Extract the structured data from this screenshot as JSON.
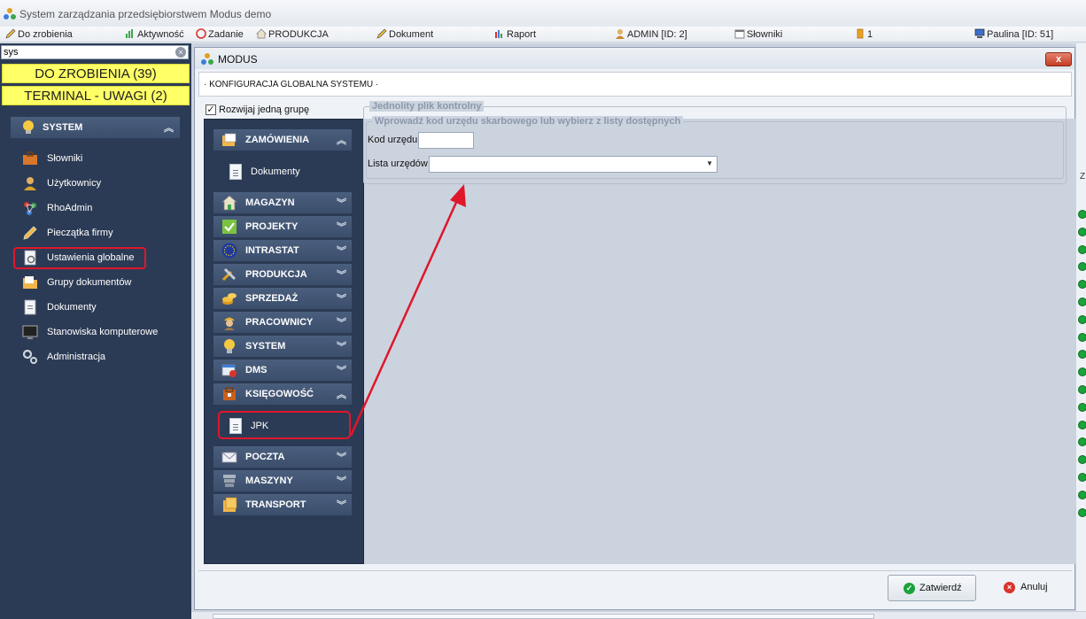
{
  "window": {
    "title": "System zarządzania przedsiębiorstwem Modus demo"
  },
  "menubar": {
    "items": [
      {
        "label": "Do zrobienia",
        "icon": "pencil-icon"
      },
      {
        "label": "Aktywność",
        "icon": "chart-icon"
      },
      {
        "label": "Zadanie",
        "icon": "task-icon"
      },
      {
        "label": "PRODUKCJA",
        "icon": "home-icon"
      },
      {
        "label": "Dokument",
        "icon": "pencil-icon"
      },
      {
        "label": "Raport",
        "icon": "bar-chart-icon"
      },
      {
        "label": "ADMIN [ID: 2]",
        "icon": "user-icon"
      },
      {
        "label": "Słowniki",
        "icon": "calendar-icon"
      },
      {
        "label": "1",
        "icon": "battery-icon"
      },
      {
        "label": "Paulina [ID: 51]",
        "icon": "computer-icon"
      }
    ]
  },
  "left": {
    "search": {
      "value": "sys"
    },
    "todo": "DO ZROBIENIA (39)",
    "terminal": "TERMINAL - UWAGI (2)",
    "group": "SYSTEM",
    "items": [
      {
        "label": "Słowniki",
        "icon": "briefcase-icon"
      },
      {
        "label": "Użytkownicy",
        "icon": "user-icon"
      },
      {
        "label": "RhoAdmin",
        "icon": "network-icon"
      },
      {
        "label": "Pieczątka firmy",
        "icon": "pen-icon"
      },
      {
        "label": "Ustawienia globalne",
        "icon": "settings-doc-icon"
      },
      {
        "label": "Grupy dokumentów",
        "icon": "folder-icon"
      },
      {
        "label": "Dokumenty",
        "icon": "document-icon"
      },
      {
        "label": "Stanowiska komputerowe",
        "icon": "monitor-icon"
      },
      {
        "label": "Administracja",
        "icon": "gears-icon"
      }
    ]
  },
  "modal": {
    "title": "MODUS",
    "close": "x",
    "header": "· KONFIGURACJA GLOBALNA SYSTEMU ·",
    "expand_one": {
      "label": "Rozwijaj jedną grupę",
      "checked": true
    },
    "groups": [
      {
        "label": "ZAMÓWIENIA",
        "icon": "orders-icon",
        "chevron": "︽"
      },
      {
        "label": "MAGAZYN",
        "icon": "warehouse-icon",
        "chevron": "︾"
      },
      {
        "label": "PROJEKTY",
        "icon": "check-icon",
        "chevron": "︾"
      },
      {
        "label": "INTRASTAT",
        "icon": "eu-flag-icon",
        "chevron": "︾"
      },
      {
        "label": "PRODUKCJA",
        "icon": "tools-icon",
        "chevron": "︾"
      },
      {
        "label": "SPRZEDAŻ",
        "icon": "coins-icon",
        "chevron": "︾"
      },
      {
        "label": "PRACOWNICY",
        "icon": "worker-icon",
        "chevron": "︾"
      },
      {
        "label": "SYSTEM",
        "icon": "bulb-icon",
        "chevron": "︾"
      },
      {
        "label": "DMS",
        "icon": "dms-icon",
        "chevron": "︾"
      },
      {
        "label": "KSIĘGOWOŚĆ",
        "icon": "accounting-icon",
        "chevron": "︽"
      },
      {
        "label": "POCZTA",
        "icon": "mail-icon",
        "chevron": "︾"
      },
      {
        "label": "MASZYNY",
        "icon": "machine-icon",
        "chevron": "︾"
      },
      {
        "label": "TRANSPORT",
        "icon": "transport-icon",
        "chevron": "︾"
      }
    ],
    "sub_orders": "Dokumenty",
    "sub_accounting": "JPK",
    "fieldset_outer": "Jednolity plik kontrolny",
    "fieldset_inner": "Wprowadź kod urzędu skarbowego lub wybierz z listy dostępnych",
    "kod_label": "Kod urzędu",
    "kod_value": "",
    "lista_label": "Lista urzędów",
    "lista_value": "",
    "confirm": "Zatwierdź",
    "cancel": "Anuluj"
  },
  "side_strip": {
    "label": "Z"
  },
  "colors": {
    "panel_bg": "#2c3b55",
    "highlight_yellow": "#ffff66",
    "annotation_red": "#e0162b",
    "confirm_green": "#1aa33a",
    "cancel_red": "#d9342b"
  }
}
